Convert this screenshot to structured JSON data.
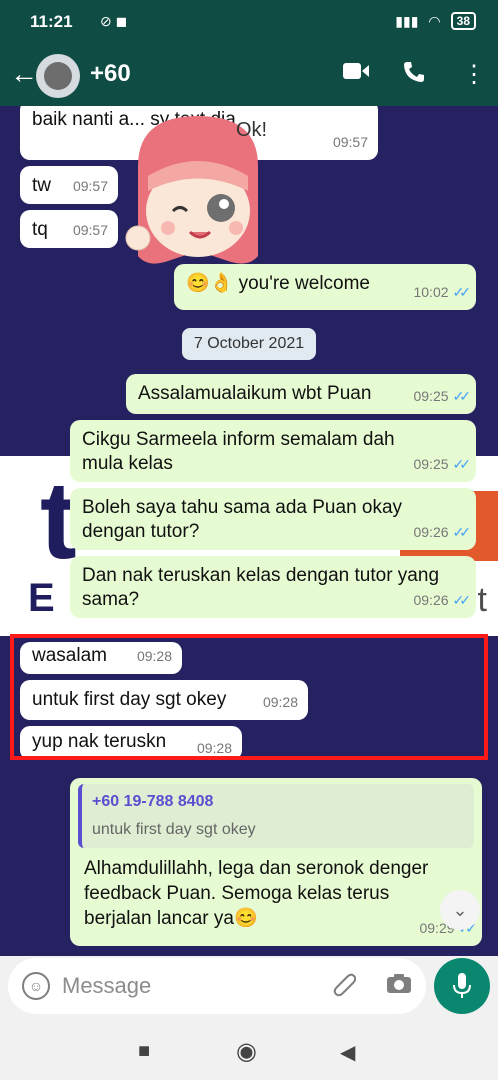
{
  "status_bar": {
    "time": "11:21",
    "battery": "38"
  },
  "header": {
    "contact_name": "+60"
  },
  "sticker": {
    "text": "Ok!"
  },
  "messages": [
    {
      "dir": "in",
      "text": "baik nanti a... sy text dia",
      "time": "09:57"
    },
    {
      "dir": "in",
      "text": "tw",
      "time": "09:57"
    },
    {
      "dir": "in",
      "text": "tq",
      "time": "09:57"
    },
    {
      "dir": "out",
      "text": "😊👌 you're welcome",
      "time": "10:02"
    },
    {
      "dir": "out",
      "text": "Assalamualaikum wbt Puan",
      "time": "09:25"
    },
    {
      "dir": "out",
      "text": "Cikgu Sarmeela inform semalam dah mula kelas",
      "time": "09:25"
    },
    {
      "dir": "out",
      "text": "Boleh saya tahu sama ada Puan okay dengan tutor?",
      "time": "09:26"
    },
    {
      "dir": "out",
      "text": "Dan nak teruskan kelas dengan tutor yang sama?",
      "time": "09:26"
    },
    {
      "dir": "in",
      "text": "wasalam",
      "time": "09:28"
    },
    {
      "dir": "in",
      "text": "untuk first day sgt okey",
      "time": "09:28"
    },
    {
      "dir": "in",
      "text": "yup nak teruskn",
      "time": "09:28"
    },
    {
      "dir": "out",
      "text": "Alhamdulillahh, lega dan seronok denger feedback Puan. Semoga kelas terus berjalan lancar ya😊",
      "time": "09:29",
      "quote": {
        "name": "+60 19-788 8408",
        "text": "untuk first day sgt okey"
      }
    }
  ],
  "date_chip": "7 October 2021",
  "input": {
    "placeholder": "Message"
  },
  "colors": {
    "header": "#0f4c44",
    "chat_bg": "#262160",
    "out_bubble": "#e7fbd3",
    "highlight": "#ff1a1a",
    "mic": "#09876f"
  }
}
